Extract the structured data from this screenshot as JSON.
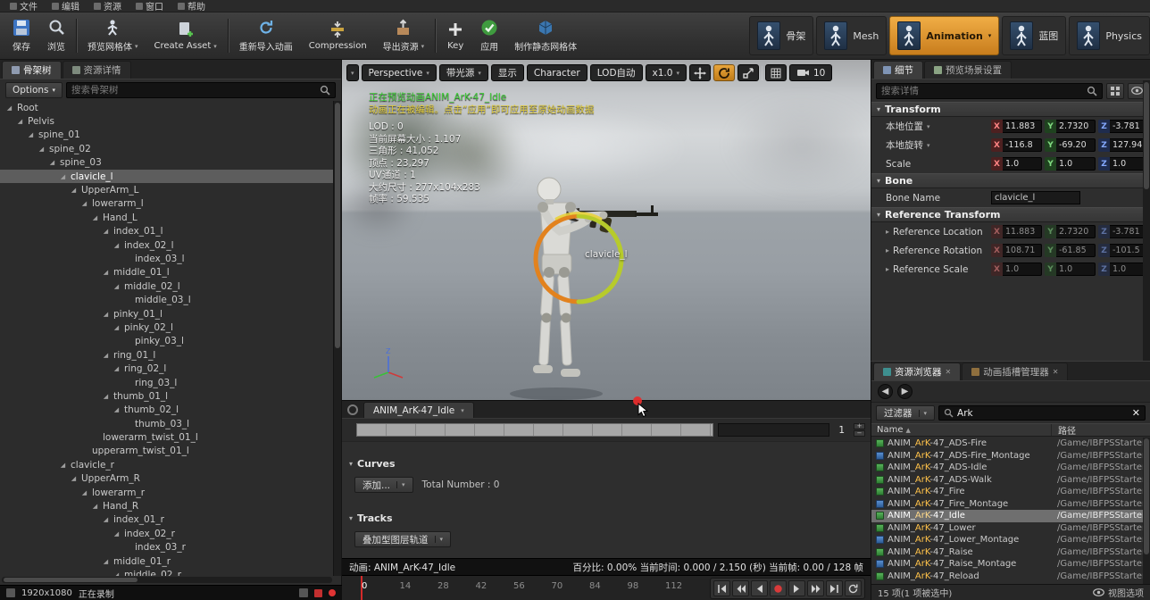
{
  "menubar": {
    "items": [
      "文件",
      "编辑",
      "资源",
      "窗口",
      "帮助"
    ]
  },
  "toolbar": {
    "buttons": [
      {
        "label": "保存"
      },
      {
        "label": "浏览"
      },
      {
        "label": "预览网格体",
        "dropdown": true
      },
      {
        "label": "Create Asset",
        "dropdown": true
      },
      {
        "label": "重新导入动画"
      },
      {
        "label": "Compression"
      },
      {
        "label": "导出资源",
        "dropdown": true
      },
      {
        "label": "Key"
      },
      {
        "label": "应用"
      },
      {
        "label": "制作静态网格体"
      }
    ],
    "modes": [
      {
        "label": "骨架"
      },
      {
        "label": "Mesh"
      },
      {
        "label": "Animation",
        "active": true
      },
      {
        "label": "蓝图"
      },
      {
        "label": "Physics"
      }
    ]
  },
  "skeleton_panel": {
    "tabs": [
      {
        "label": "骨架树",
        "active": true
      },
      {
        "label": "资源详情"
      }
    ],
    "options_label": "Options",
    "search_placeholder": "搜索骨架树",
    "tree": [
      {
        "n": "Root",
        "l": 0
      },
      {
        "n": "Pelvis",
        "l": 1
      },
      {
        "n": "spine_01",
        "l": 2
      },
      {
        "n": "spine_02",
        "l": 3
      },
      {
        "n": "spine_03",
        "l": 4
      },
      {
        "n": "clavicle_l",
        "l": 5,
        "selected": true
      },
      {
        "n": "UpperArm_L",
        "l": 6
      },
      {
        "n": "lowerarm_l",
        "l": 7
      },
      {
        "n": "Hand_L",
        "l": 8
      },
      {
        "n": "index_01_l",
        "l": 9
      },
      {
        "n": "index_02_l",
        "l": 10
      },
      {
        "n": "index_03_l",
        "l": 11,
        "leaf": true
      },
      {
        "n": "middle_01_l",
        "l": 9
      },
      {
        "n": "middle_02_l",
        "l": 10
      },
      {
        "n": "middle_03_l",
        "l": 11,
        "leaf": true
      },
      {
        "n": "pinky_01_l",
        "l": 9
      },
      {
        "n": "pinky_02_l",
        "l": 10
      },
      {
        "n": "pinky_03_l",
        "l": 11,
        "leaf": true
      },
      {
        "n": "ring_01_l",
        "l": 9
      },
      {
        "n": "ring_02_l",
        "l": 10
      },
      {
        "n": "ring_03_l",
        "l": 11,
        "leaf": true
      },
      {
        "n": "thumb_01_l",
        "l": 9
      },
      {
        "n": "thumb_02_l",
        "l": 10
      },
      {
        "n": "thumb_03_l",
        "l": 11,
        "leaf": true
      },
      {
        "n": "lowerarm_twist_01_l",
        "l": 8,
        "leaf": true
      },
      {
        "n": "upperarm_twist_01_l",
        "l": 7,
        "leaf": true
      },
      {
        "n": "clavicle_r",
        "l": 5
      },
      {
        "n": "UpperArm_R",
        "l": 6
      },
      {
        "n": "lowerarm_r",
        "l": 7
      },
      {
        "n": "Hand_R",
        "l": 8
      },
      {
        "n": "index_01_r",
        "l": 9
      },
      {
        "n": "index_02_r",
        "l": 10
      },
      {
        "n": "index_03_r",
        "l": 11,
        "leaf": true
      },
      {
        "n": "middle_01_r",
        "l": 9
      },
      {
        "n": "middle_02_r",
        "l": 10
      }
    ]
  },
  "viewport": {
    "toolbar": {
      "perspective": "Perspective",
      "lit": "带光源",
      "show": "显示",
      "character": "Character",
      "lod": "LOD自动",
      "speed": "x1.0",
      "camera_speed": "10"
    },
    "overlay": {
      "line1": "正在预览动画ANIM_ArK-47_Idle",
      "line2": "动画正在被编辑。点击“应用”即可应用至原始动画数据",
      "stats": [
        "LOD : 0",
        "当前屏幕大小 : 1.107",
        "三角形 : 41,052",
        "顶点 : 23,297",
        "UV通道 : 1",
        "大约尺寸 : 277x104x283",
        "帧率 : 59.535"
      ]
    },
    "bone_label": "clavicle_l"
  },
  "timeline": {
    "tab_label": "ANIM_ArK-47_Idle",
    "frame_value": "1",
    "curves_title": "Curves",
    "curves_add": "添加...",
    "curves_total": "Total Number : 0",
    "tracks_title": "Tracks",
    "tracks_layer": "叠加型图层轨道",
    "status_left": "动画: ANIM_ArK-47_Idle",
    "status_right": "百分比: 0.00%  当前时间: 0.000 / 2.150 (秒)  当前帧: 0.00 / 128 帧",
    "ruler_numbers": [
      "0",
      "14",
      "28",
      "42",
      "56",
      "70",
      "84",
      "98",
      "112"
    ]
  },
  "details": {
    "tabs": [
      {
        "label": "细节",
        "active": true
      },
      {
        "label": "预览场景设置"
      }
    ],
    "search_placeholder": "搜索详情",
    "transform_title": "Transform",
    "rows_transform": [
      {
        "label": "本地位置",
        "caret": true,
        "x": "11.883",
        "y": "2.7320",
        "z": "-3.781"
      },
      {
        "label": "本地旋转",
        "caret": true,
        "x": "-116.8",
        "y": "-69.20",
        "z": "127.94"
      },
      {
        "label": "Scale",
        "x": "1.0",
        "y": "1.0",
        "z": "1.0"
      }
    ],
    "bone_title": "Bone",
    "bone_name_label": "Bone Name",
    "bone_name_value": "clavicle_l",
    "reference_title": "Reference Transform",
    "rows_reference": [
      {
        "label": "Reference Location",
        "expander": true,
        "x": "11.883",
        "y": "2.7320",
        "z": "-3.781"
      },
      {
        "label": "Reference Rotation",
        "expander": true,
        "x": "108.71",
        "y": "-61.85",
        "z": "-101.5"
      },
      {
        "label": "Reference Scale",
        "expander": true,
        "x": "1.0",
        "y": "1.0",
        "z": "1.0"
      }
    ]
  },
  "asset_browser": {
    "tabs": [
      {
        "label": "资源浏览器",
        "active": true
      },
      {
        "label": "动画插槽管理器"
      }
    ],
    "filter_label": "过滤器",
    "search_value": "Ark",
    "columns": [
      "Name",
      "路径"
    ],
    "rows": [
      {
        "name": "ANIM_ArK-47_ADS-Fire",
        "path": "/Game/IBFPSStarter"
      },
      {
        "name": "ANIM_ArK-47_ADS-Fire_Montage",
        "path": "/Game/IBFPSStarter",
        "montage": true
      },
      {
        "name": "ANIM_ArK-47_ADS-Idle",
        "path": "/Game/IBFPSStarter"
      },
      {
        "name": "ANIM_ArK-47_ADS-Walk",
        "path": "/Game/IBFPSStarter"
      },
      {
        "name": "ANIM_ArK-47_Fire",
        "path": "/Game/IBFPSStarter"
      },
      {
        "name": "ANIM_ArK-47_Fire_Montage",
        "path": "/Game/IBFPSStarter",
        "montage": true
      },
      {
        "name": "ANIM_ArK-47_Idle",
        "path": "/Game/IBFPSStarter",
        "selected": true
      },
      {
        "name": "ANIM_ArK-47_Lower",
        "path": "/Game/IBFPSStarter"
      },
      {
        "name": "ANIM_ArK-47_Lower_Montage",
        "path": "/Game/IBFPSStarter",
        "montage": true
      },
      {
        "name": "ANIM_ArK-47_Raise",
        "path": "/Game/IBFPSStarter"
      },
      {
        "name": "ANIM_ArK-47_Raise_Montage",
        "path": "/Game/IBFPSStarter",
        "montage": true
      },
      {
        "name": "ANIM_ArK-47_Reload",
        "path": "/Game/IBFPSStarter"
      }
    ],
    "footer": "15 项(1 项被选中)",
    "view_options_label": "视图选项"
  },
  "recorder": {
    "resolution": "1920x1080",
    "status": "正在录制"
  }
}
